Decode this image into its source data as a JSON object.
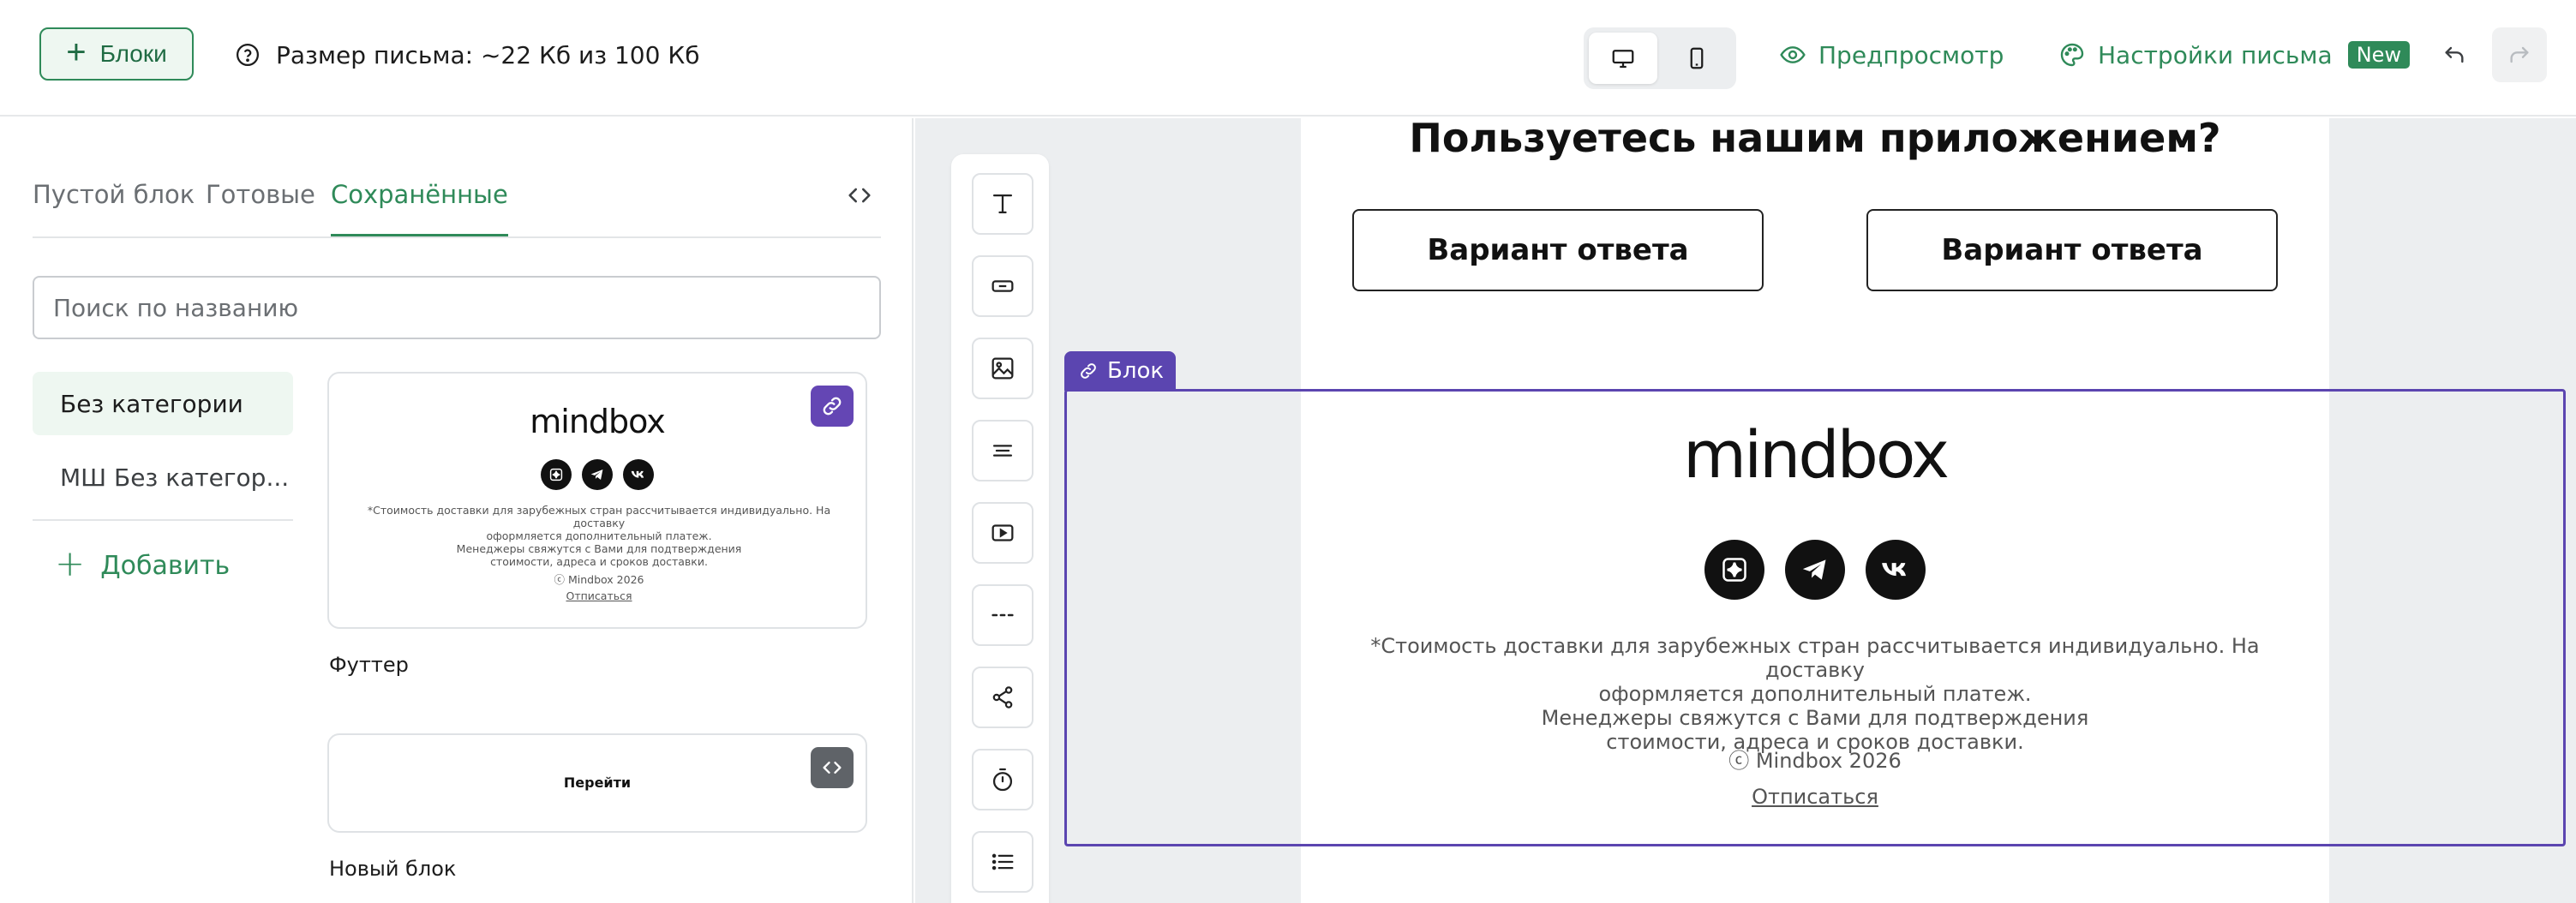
{
  "header": {
    "blocks_button": "Блоки",
    "size_info": "Размер письма: ~22 Кб из 100 Кб",
    "device_modes": [
      "desktop",
      "mobile"
    ],
    "active_device": "desktop",
    "preview": "Предпросмотр",
    "settings": "Настройки письма",
    "new_badge": "New"
  },
  "panel": {
    "tabs": [
      "Пустой блок",
      "Готовые",
      "Сохранённые"
    ],
    "active_tab": "Сохранённые",
    "search_placeholder": "Поиск по названию",
    "categories": [
      "Без категории",
      "МШ Без категор..."
    ],
    "active_category": "Без категории",
    "add_category": "Добавить",
    "cards": [
      {
        "label": "Футтер",
        "badge": "link-icon",
        "preview": {
          "logo": "mindbox",
          "text_lines": [
            "*Стоимость доставки для зарубежных стран рассчитывается индивидуально. На доставку",
            "оформляется дополнительный платеж.",
            "Менеджеры свяжутся с Вами для подтверждения",
            "стоимости, адреса и сроков доставки."
          ],
          "copyright": "ⓒ Mindbox 2026",
          "unsubscribe": "Отписаться"
        }
      },
      {
        "label": "Новый блок",
        "badge": "code-icon",
        "preview": {
          "button_text": "Перейти"
        }
      }
    ]
  },
  "toolbar": {
    "tools": [
      "text-icon",
      "button-icon",
      "image-icon",
      "text-block-icon",
      "video-icon",
      "divider-icon",
      "social-icon",
      "timer-icon",
      "list-icon"
    ]
  },
  "email": {
    "question": "Пользуетесь нашим приложением?",
    "answers": [
      "Вариант ответа",
      "Вариант ответа"
    ],
    "selection_tag": "Блок",
    "footer": {
      "logo": "mindbox",
      "social": [
        "sparkle-icon",
        "telegram-icon",
        "vk-icon"
      ],
      "text_lines": [
        "*Стоимость доставки для зарубежных стран рассчитывается индивидуально. На доставку",
        "оформляется дополнительный платеж.",
        "Менеджеры свяжутся с Вами для подтверждения",
        "стоимости, адреса и сроков доставки."
      ],
      "copyright": "ⓒ Mindbox 2026",
      "unsubscribe": "Отписаться"
    }
  },
  "colors": {
    "accent": "#2f8a59",
    "selection": "#5b45b0",
    "canvas_bg": "#eceef0"
  }
}
